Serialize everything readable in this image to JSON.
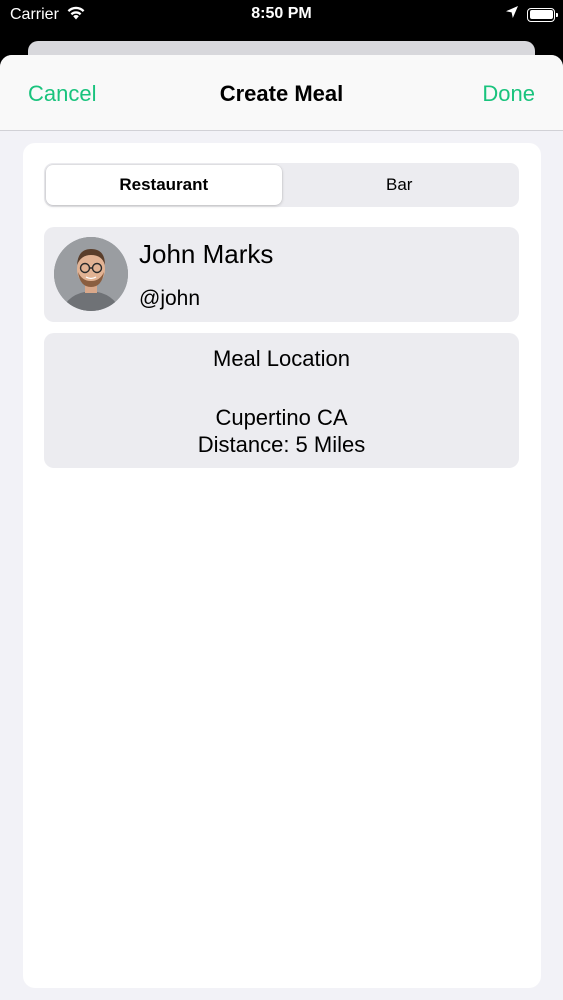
{
  "status_bar": {
    "carrier": "Carrier",
    "time": "8:50 PM",
    "icons": [
      "wifi-icon",
      "location-arrow-icon",
      "battery-icon"
    ]
  },
  "nav": {
    "cancel_label": "Cancel",
    "title": "Create Meal",
    "done_label": "Done",
    "accent_color": "#19c37d"
  },
  "segments": {
    "options": [
      "Restaurant",
      "Bar"
    ],
    "selected": "Restaurant"
  },
  "user": {
    "name": "John Marks",
    "handle": "@john"
  },
  "location": {
    "title": "Meal Location",
    "city": "Cupertino CA",
    "distance": "Distance: 5 Miles"
  }
}
